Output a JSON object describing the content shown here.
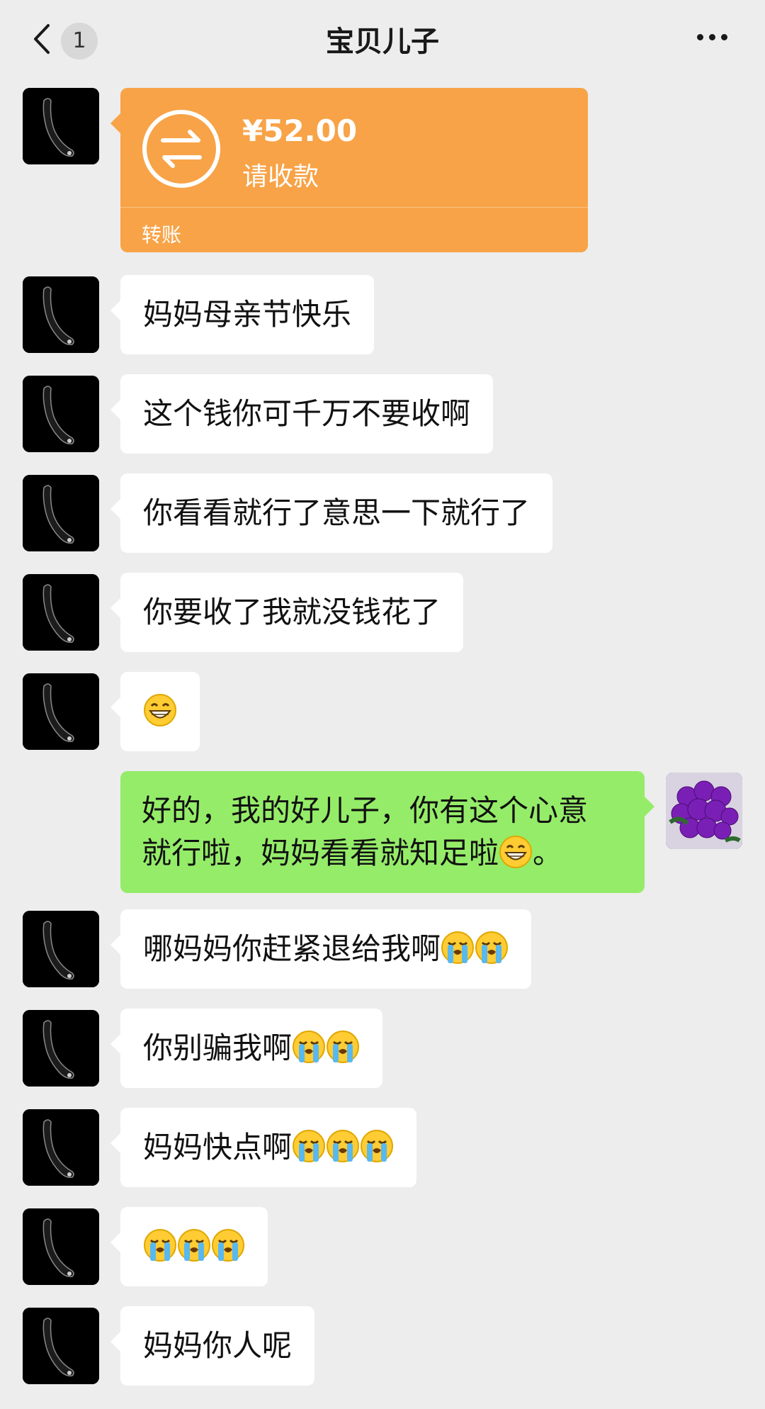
{
  "header": {
    "title": "宝贝儿子",
    "unread_count": "1",
    "back_icon": "chevron-left-icon",
    "more_icon": "more-horizontal-icon"
  },
  "transfer": {
    "amount": "¥52.00",
    "status": "请收款",
    "label": "转账",
    "color": "#f8a347",
    "icon": "transfer-arrows-icon"
  },
  "messages": [
    {
      "side": "left",
      "text": "妈妈母亲节快乐",
      "emojis": []
    },
    {
      "side": "left",
      "text": "这个钱你可千万不要收啊",
      "emojis": []
    },
    {
      "side": "left",
      "text": "你看看就行了意思一下就行了",
      "emojis": []
    },
    {
      "side": "left",
      "text": "你要收了我就没钱花了",
      "emojis": []
    },
    {
      "side": "left",
      "text": "",
      "emojis": [
        "grin-emoji"
      ]
    },
    {
      "side": "right",
      "text_line1": "好的，我的好儿子，你有这个心意",
      "text_line2": "就行啦，妈妈看看就知足啦",
      "text_after": "。",
      "emojis": [
        "grin-emoji"
      ]
    },
    {
      "side": "left",
      "text": "哪妈妈你赶紧退给我啊",
      "emojis": [
        "crying-emoji",
        "crying-emoji"
      ]
    },
    {
      "side": "left",
      "text": "你别骗我啊",
      "emojis": [
        "crying-emoji",
        "crying-emoji"
      ]
    },
    {
      "side": "left",
      "text": "妈妈快点啊",
      "emojis": [
        "crying-emoji",
        "crying-emoji",
        "crying-emoji"
      ]
    },
    {
      "side": "left",
      "text": "",
      "emojis": [
        "crying-emoji",
        "crying-emoji",
        "crying-emoji"
      ]
    },
    {
      "side": "left",
      "text": "妈妈你人呢",
      "emojis": []
    }
  ],
  "colors": {
    "background": "#ededed",
    "incoming_bubble": "#ffffff",
    "outgoing_bubble": "#95ec69"
  }
}
